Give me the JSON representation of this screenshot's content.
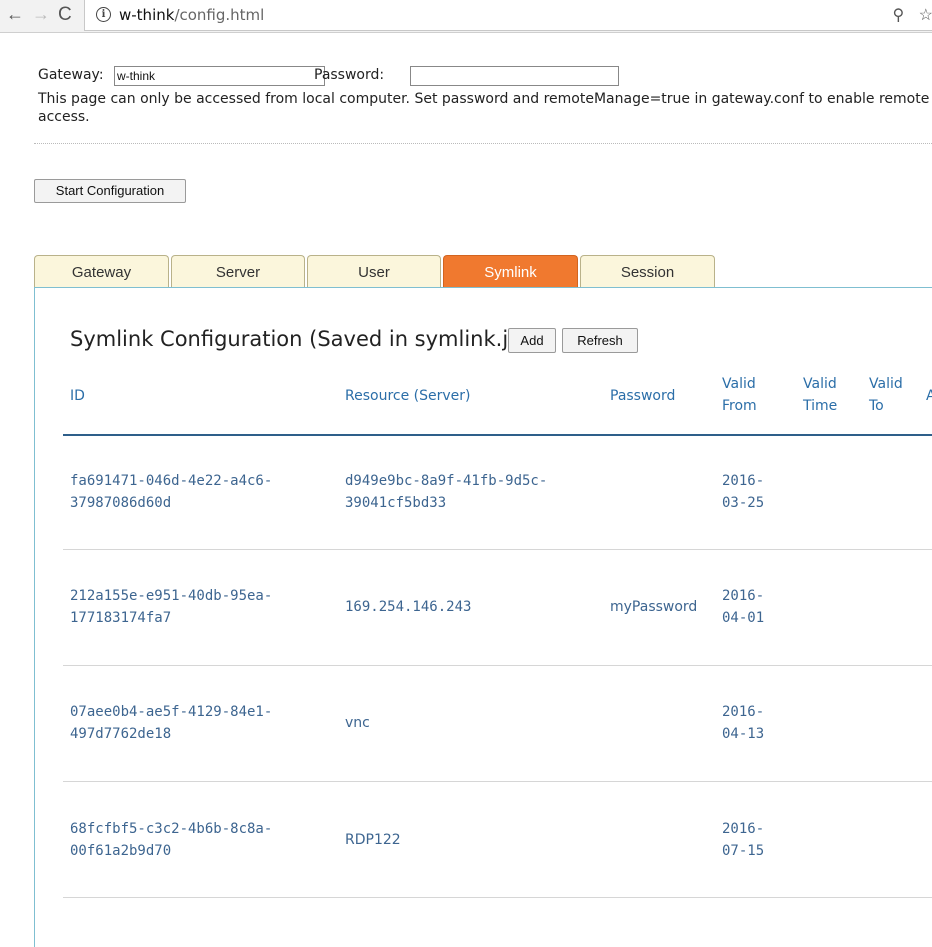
{
  "browser": {
    "url_host": "w-think",
    "url_path": "/config.html",
    "back_icon": "←",
    "forward_icon": "→",
    "reload_icon": "C",
    "info_icon": "i",
    "key_icon": "⚲",
    "star_icon": "☆"
  },
  "form": {
    "gateway_label": "Gateway:",
    "gateway_value": "w-think",
    "password_label": "Password:",
    "password_value": "",
    "notice": "This page can only be accessed from local computer. Set password and remoteManage=true in gateway.conf to enable remote access."
  },
  "start_button": "Start Configuration",
  "tabs": [
    {
      "label": "Gateway"
    },
    {
      "label": "Server"
    },
    {
      "label": "User"
    },
    {
      "label": "Symlink"
    },
    {
      "label": "Session"
    }
  ],
  "active_tab": "Symlink",
  "panel": {
    "title": "Symlink Configuration (Saved in symlink.json)",
    "add_label": "Add",
    "refresh_label": "Refresh"
  },
  "table": {
    "headers": {
      "id": "ID",
      "resource": "Resource (Server)",
      "password": "Password",
      "valid_from_1": "Valid",
      "valid_from_2": "From",
      "valid_time_1": "Valid",
      "valid_time_2": "Time",
      "valid_to_1": "Valid",
      "valid_to_2": "To",
      "extra": "A"
    },
    "rows": [
      {
        "id_1": "fa691471-046d-4e22-a4c6-",
        "id_2": "37987086d60d",
        "res_1": "d949e9bc-8a9f-41fb-9d5c-",
        "res_2": "39041cf5bd33",
        "password": "",
        "from_1": "2016-",
        "from_2": "03-25"
      },
      {
        "id_1": "212a155e-e951-40db-95ea-",
        "id_2": "177183174fa7",
        "res": "169.254.146.243",
        "password": "myPassword",
        "from_1": "2016-",
        "from_2": "04-01"
      },
      {
        "id_1": "07aee0b4-ae5f-4129-84e1-",
        "id_2": "497d7762de18",
        "res": "vnc",
        "password": "",
        "from_1": "2016-",
        "from_2": "04-13"
      },
      {
        "id_1": "68fcfbf5-c3c2-4b6b-8c8a-",
        "id_2": "00f61a2b9d70",
        "res": "RDP122",
        "password": "",
        "from_1": "2016-",
        "from_2": "07-15"
      }
    ]
  }
}
